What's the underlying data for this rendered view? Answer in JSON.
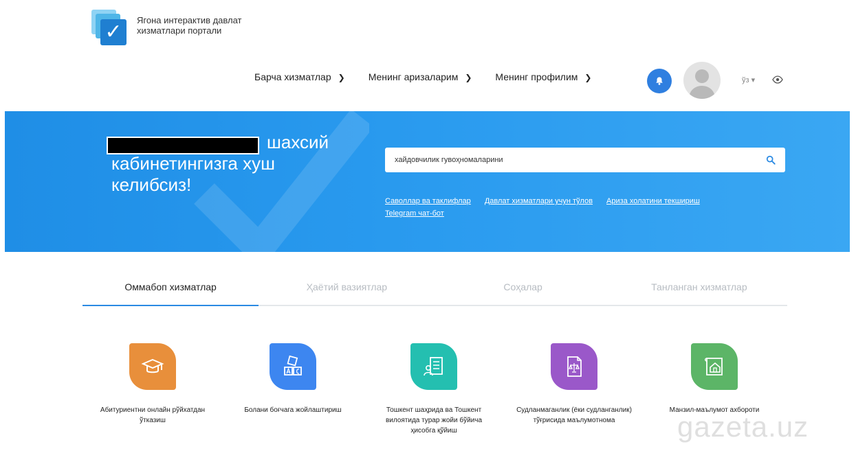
{
  "header": {
    "logo_line1": "Ягона интерактив давлат",
    "logo_line2": "хизматлари портали",
    "nav": [
      {
        "label": "Барча хизматлар"
      },
      {
        "label": "Менинг аризаларим"
      },
      {
        "label": "Менинг профилим"
      }
    ],
    "lang_label": "ўз",
    "lang_caret": "▾"
  },
  "banner": {
    "welcome_text": "шахсий кабинетингизга хуш келибсиз!",
    "search_value": "хайдовчилик гувоҳномаларини",
    "links": [
      "Саволлар ва таклифлар",
      "Давлат хизматлари учун тўлов",
      "Ариза холатини текшириш",
      "Telegram чат-бот"
    ]
  },
  "tabs": [
    {
      "label": "Оммабоп хизматлар",
      "active": true
    },
    {
      "label": "Ҳаётий вазиятлар",
      "active": false
    },
    {
      "label": "Соҳалар",
      "active": false
    },
    {
      "label": "Танланган хизматлар",
      "active": false
    }
  ],
  "services": [
    {
      "label": "Абитуриентни онлайн рўйхатдан ўтказиш",
      "color": "#e88f3b",
      "icon": "graduation-cap-icon"
    },
    {
      "label": "Болани боғчага жойлаштириш",
      "color": "#3d86f0",
      "icon": "abc-blocks-icon"
    },
    {
      "label": "Тошкент шаҳрида ва Тошкент вилоятида турар жойи бўйича ҳисобга қўйиш",
      "color": "#24bfb0",
      "icon": "person-document-icon"
    },
    {
      "label": "Судланмаганлик (ёки судланганлик) тўғрисида маълумотнома",
      "color": "#9a58c9",
      "icon": "legal-document-icon"
    },
    {
      "label": "Манзил-маълумот ахбороти",
      "color": "#5cb567",
      "icon": "house-plan-icon"
    }
  ],
  "watermark": "gazeta.uz",
  "colors": {
    "banner": "#2196ee",
    "accent": "#2a8ae3"
  }
}
